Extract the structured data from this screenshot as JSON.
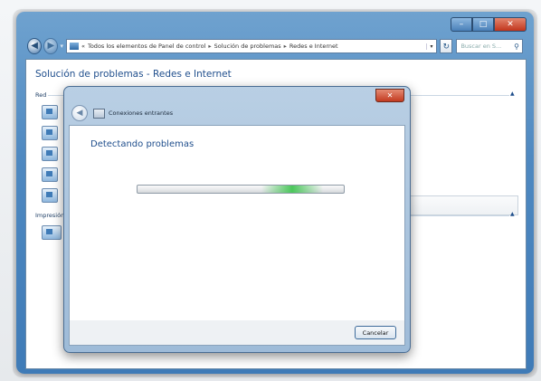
{
  "explorer": {
    "breadcrumb": {
      "root": "«",
      "items": [
        "Todos los elementos de Panel de control",
        "Solución de problemas",
        "Redes e Internet"
      ]
    },
    "search_placeholder": "Buscar en S... ",
    "page_title": "Solución de problemas - Redes e Internet",
    "sections": {
      "network": "Red",
      "printing": "Impresión"
    }
  },
  "dialog": {
    "title": "Conexiones entrantes",
    "message": "Detectando problemas",
    "progress": 0.75,
    "cancel_label": "Cancelar"
  },
  "colors": {
    "title_blue": "#1f4e8c",
    "frame_blue": "#4f89c1",
    "progress_green": "#4cc75c",
    "close_red": "#c23a20"
  },
  "icons": [
    "back-icon",
    "forward-icon",
    "control-panel-icon",
    "refresh-icon",
    "search-icon",
    "network-icon",
    "printer-icon",
    "troubleshoot-icon"
  ]
}
